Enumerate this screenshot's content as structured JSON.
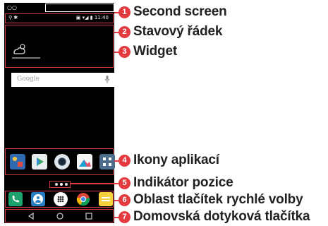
{
  "phone": {
    "status_bar": {
      "left_icons": "⚲ ✱",
      "right_text": "▣ ▾◢ ▮ 11:40"
    },
    "search": {
      "placeholder": "Google"
    },
    "apps_row": [
      "gallery-icon",
      "play-store-icon",
      "camera-icon",
      "photos-icon",
      "apps-folder-icon"
    ],
    "quick_access": [
      "phone-icon",
      "contacts-icon",
      "apps-drawer-icon",
      "chrome-icon",
      "messaging-icon"
    ],
    "nav_buttons": [
      "back-icon",
      "home-icon",
      "recent-apps-icon"
    ]
  },
  "callouts": [
    {
      "num": "1",
      "label": "Second screen"
    },
    {
      "num": "2",
      "label": "Stavový řádek"
    },
    {
      "num": "3",
      "label": "Widget"
    },
    {
      "num": "4",
      "label": "Ikony aplikací"
    },
    {
      "num": "5",
      "label": "Indikátor pozice"
    },
    {
      "num": "6",
      "label": "Oblast tlačítek rychlé volby"
    },
    {
      "num": "7",
      "label": "Domovská dotyková tlačítka"
    }
  ],
  "colors": {
    "accent": "#e23a3f",
    "frame": "#d13a40",
    "screen": "#000000"
  }
}
